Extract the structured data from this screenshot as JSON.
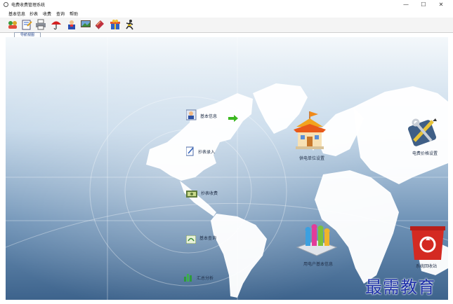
{
  "window": {
    "title": "电费收费管理系统",
    "minimize": "—",
    "maximize": "☐",
    "close": "✕"
  },
  "menu": [
    "基本信息",
    "抄表",
    "收费",
    "查询",
    "帮助"
  ],
  "toolbar_icons": [
    "users-icon",
    "report-icon",
    "printer-icon",
    "umbrella-icon",
    "person-icon",
    "monitor-icon",
    "book-icon",
    "gift-icon",
    "runner-icon"
  ],
  "tab": {
    "label": "导航视图"
  },
  "nav": {
    "basic_info": "基本信息",
    "meter_entry": "抄表录入",
    "meter_charge": "抄表收费",
    "basic_query": "基本查询",
    "summary": "汇总分析",
    "company_settings": "供电单位设置",
    "price_settings": "电费价格设置",
    "customer_mgmt": "用电户基本信息",
    "recycle_bin": "系统回收站"
  },
  "watermark": "最需教育",
  "colors": {
    "ocean_light": "#eaf3f9",
    "ocean_mid": "#a9c6de",
    "ocean_deep": "#3f6993",
    "land": "#ffffff",
    "accent_blue": "#1c2fa8"
  }
}
